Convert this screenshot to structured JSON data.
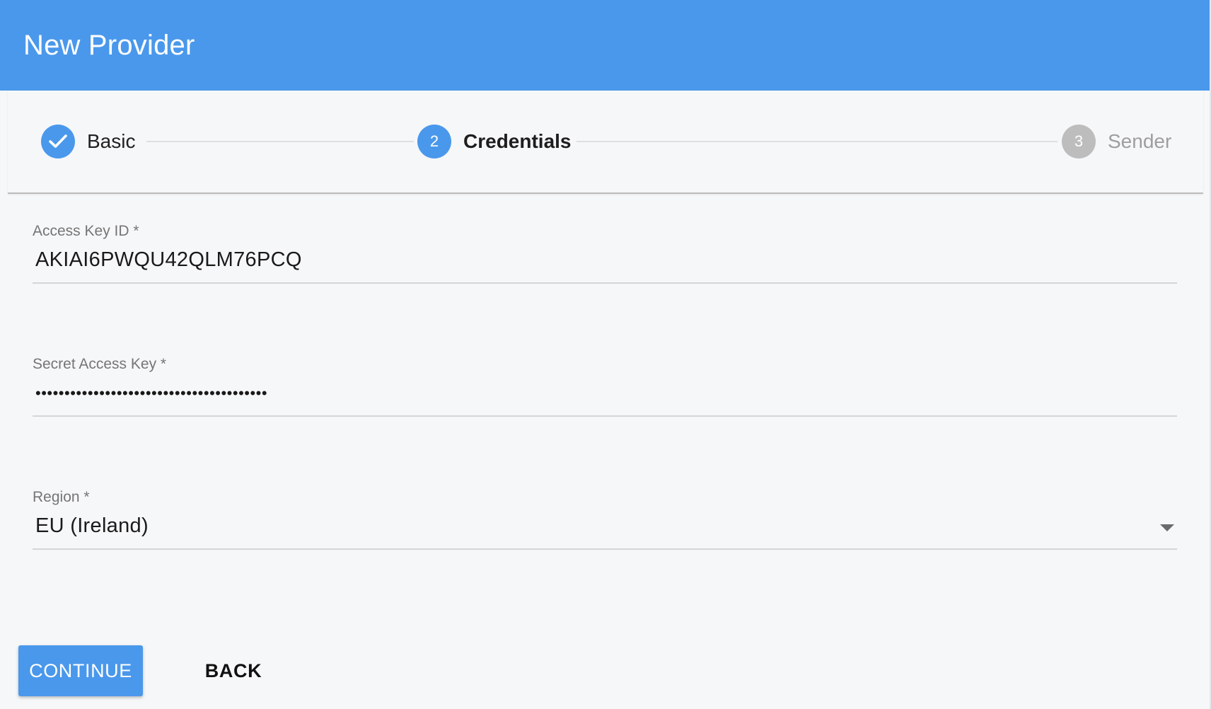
{
  "dialog": {
    "title": "New Provider"
  },
  "stepper": {
    "steps": [
      {
        "number": "1",
        "label": "Basic",
        "state": "completed",
        "icon": "check-icon"
      },
      {
        "number": "2",
        "label": "Credentials",
        "state": "active"
      },
      {
        "number": "3",
        "label": "Sender",
        "state": "inactive"
      }
    ]
  },
  "form": {
    "access_key_id": {
      "label": "Access Key ID *",
      "value": "AKIAI6PWQU42QLM76PCQ"
    },
    "secret_access_key": {
      "label": "Secret Access Key *",
      "masked_value": "••••••••••••••••••••••••••••••••••••••••"
    },
    "region": {
      "label": "Region *",
      "selected": "EU (Ireland)",
      "icon": "dropdown-arrow-icon"
    }
  },
  "actions": {
    "continue_label": "CONTINUE",
    "back_label": "BACK"
  },
  "colors": {
    "primary": "#4a98eb",
    "inactive_step": "#bdbdbd",
    "background": "#f6f7f9"
  }
}
